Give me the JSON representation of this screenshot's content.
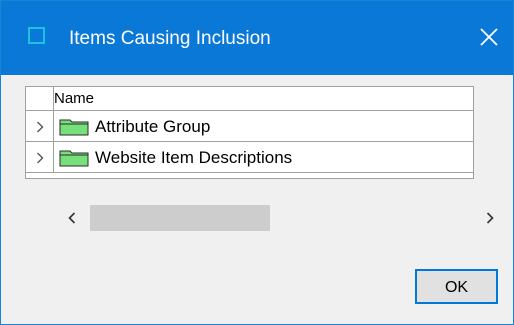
{
  "window": {
    "title": "Items Causing Inclusion",
    "icons": {
      "app": "app-window-icon",
      "close": "close-icon"
    }
  },
  "tree": {
    "column_header": "Name",
    "rows": [
      {
        "label": "Attribute Group",
        "icon": "folder-icon",
        "expander": "chevron-right-icon"
      },
      {
        "label": "Website Item Descriptions",
        "icon": "folder-icon",
        "expander": "chevron-right-icon"
      }
    ]
  },
  "scrollbar": {
    "left_icon": "chevron-left-icon",
    "right_icon": "chevron-right-icon"
  },
  "buttons": {
    "ok": "OK"
  },
  "colors": {
    "titlebar": "#0a78d7",
    "app_icon": "#1fc1dc",
    "folder_fill": "#77e07a",
    "button_border": "#0078d7"
  }
}
